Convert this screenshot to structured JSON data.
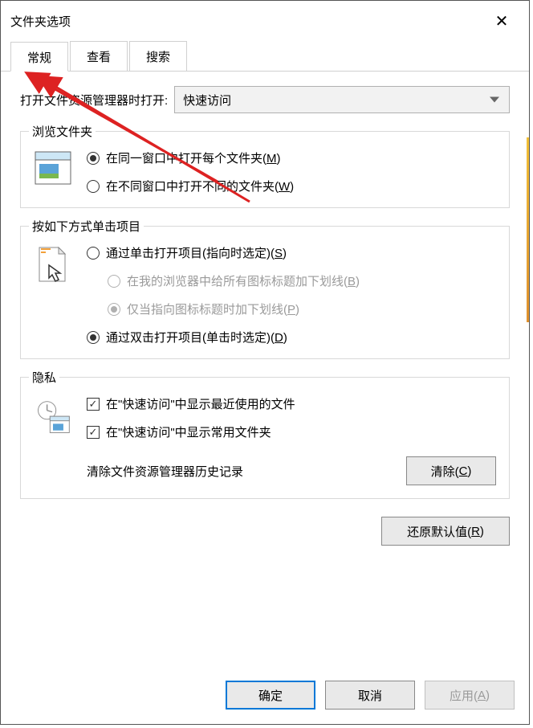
{
  "title": "文件夹选项",
  "tabs": [
    "常规",
    "查看",
    "搜索"
  ],
  "activeTab": 0,
  "openLabel": "打开文件资源管理器时打开:",
  "combo": {
    "value": "快速访问"
  },
  "browse": {
    "title": "浏览文件夹",
    "opt1": {
      "label": "在同一窗口中打开每个文件夹(",
      "key": "M",
      "suffix": ")"
    },
    "opt2": {
      "label": "在不同窗口中打开不同的文件夹(",
      "key": "W",
      "suffix": ")"
    }
  },
  "click": {
    "title": "按如下方式单击项目",
    "opt1": {
      "label": "通过单击打开项目(指向时选定)(",
      "key": "S",
      "suffix": ")"
    },
    "sub1": {
      "label": "在我的浏览器中给所有图标标题加下划线(",
      "key": "B",
      "suffix": ")"
    },
    "sub2": {
      "label": "仅当指向图标标题时加下划线(",
      "key": "P",
      "suffix": ")"
    },
    "opt2": {
      "label": "通过双击打开项目(单击时选定)(",
      "key": "D",
      "suffix": ")"
    }
  },
  "privacy": {
    "title": "隐私",
    "chk1": "在\"快速访问\"中显示最近使用的文件",
    "chk2": "在\"快速访问\"中显示常用文件夹",
    "clearLabel": "清除文件资源管理器历史记录",
    "clearBtn": {
      "label": "清除(",
      "key": "C",
      "suffix": ")"
    }
  },
  "restoreBtn": {
    "label": "还原默认值(",
    "key": "R",
    "suffix": ")"
  },
  "buttons": {
    "ok": "确定",
    "cancel": "取消",
    "apply": {
      "label": "应用(",
      "key": "A",
      "suffix": ")"
    }
  }
}
